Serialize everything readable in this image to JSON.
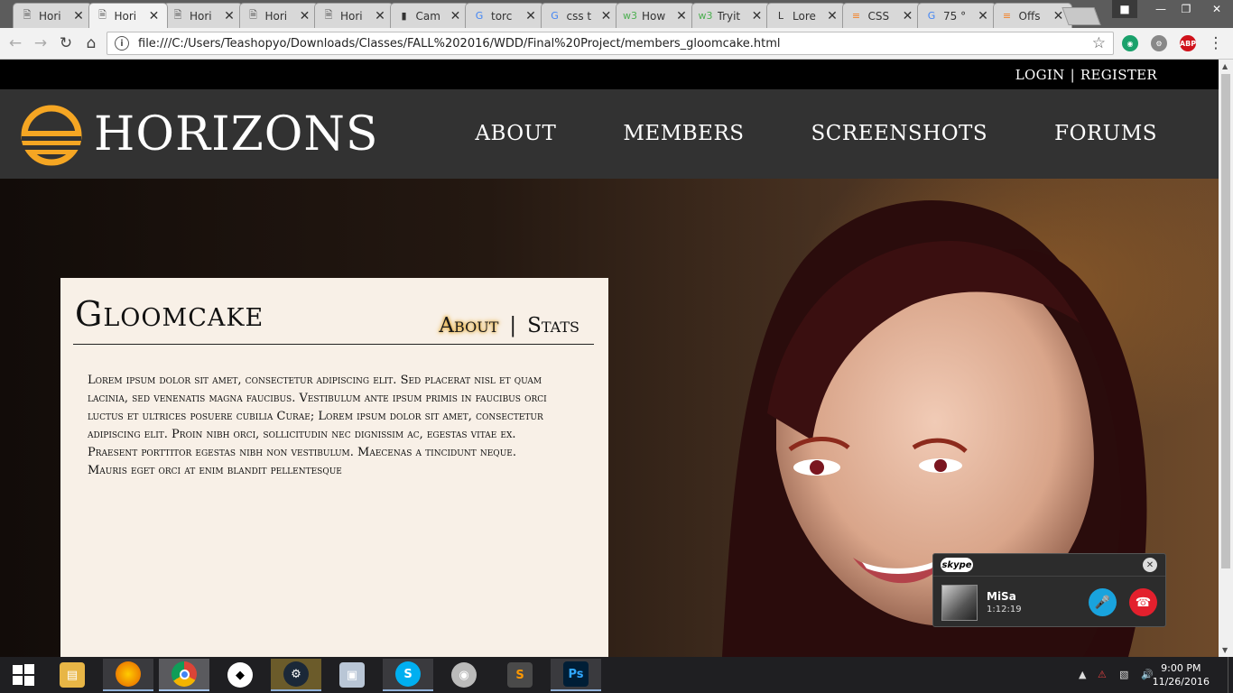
{
  "browser": {
    "tabs": [
      {
        "label": "Hori",
        "icon": "page-icon",
        "active": false
      },
      {
        "label": "Hori",
        "icon": "page-icon",
        "active": true
      },
      {
        "label": "Hori",
        "icon": "page-icon",
        "active": false
      },
      {
        "label": "Hori",
        "icon": "page-icon",
        "active": false
      },
      {
        "label": "Hori",
        "icon": "page-icon",
        "active": false
      },
      {
        "label": "Cam",
        "icon": "site-icon",
        "active": false
      },
      {
        "label": "torc",
        "icon": "google-icon",
        "active": false
      },
      {
        "label": "css t",
        "icon": "google-icon",
        "active": false
      },
      {
        "label": "How",
        "icon": "w3schools-icon",
        "active": false
      },
      {
        "label": "Tryit",
        "icon": "w3schools-icon",
        "active": false
      },
      {
        "label": "Lore",
        "icon": "lipsum-icon",
        "active": false
      },
      {
        "label": "CSS",
        "icon": "stackoverflow-icon",
        "active": false
      },
      {
        "label": "75 °",
        "icon": "google-icon",
        "active": false
      },
      {
        "label": "Offs",
        "icon": "stackoverflow-icon",
        "active": false
      }
    ],
    "url": "file:///C:/Users/Teashopyo/Downloads/Classes/FALL%202016/WDD/Final%20Project/members_gloomcake.html",
    "extensions": [
      "eye-extension-icon",
      "gear-extension-icon",
      "adblock-icon"
    ],
    "adblock_label": "ABP"
  },
  "site": {
    "auth": {
      "login": "LOGIN",
      "separator": "|",
      "register": "REGISTER"
    },
    "brand": "HORIZONS",
    "nav": [
      "ABOUT",
      "MEMBERS",
      "SCREENSHOTS",
      "FORUMS"
    ],
    "member": {
      "name": "Gloomcake",
      "tab_about": "About",
      "tab_separator": "|",
      "tab_stats": "Stats",
      "bio": "Lorem ipsum dolor sit amet, consectetur adipiscing elit. Sed placerat nisl et quam lacinia, sed venenatis magna faucibus. Vestibulum ante ipsum primis in faucibus orci luctus et ultrices posuere cubilia Curae; Lorem ipsum dolor sit amet, consectetur adipiscing elit. Proin nibh orci, sollicitudin nec dignissim ac, egestas vitae ex. Praesent porttitor egestas nibh non vestibulum. Maecenas a tincidunt neque. Mauris eget orci at enim blandit pellentesque"
    },
    "colors": {
      "accent": "#f5a623",
      "nav_bg": "#323232",
      "panel_bg": "#f8f0e7"
    }
  },
  "skype": {
    "brand": "skype",
    "caller": "MiSa",
    "duration": "1:12:19"
  },
  "taskbar": {
    "apps": [
      "file-explorer-icon",
      "firefox-icon",
      "chrome-icon",
      "foobar-icon",
      "steam-icon",
      "window-icon",
      "skype-icon",
      "speaker-app-icon",
      "sublime-icon",
      "photoshop-icon"
    ],
    "photoshop_label": "Ps",
    "clock_time": "9:00 PM",
    "clock_date": "11/26/2016"
  }
}
